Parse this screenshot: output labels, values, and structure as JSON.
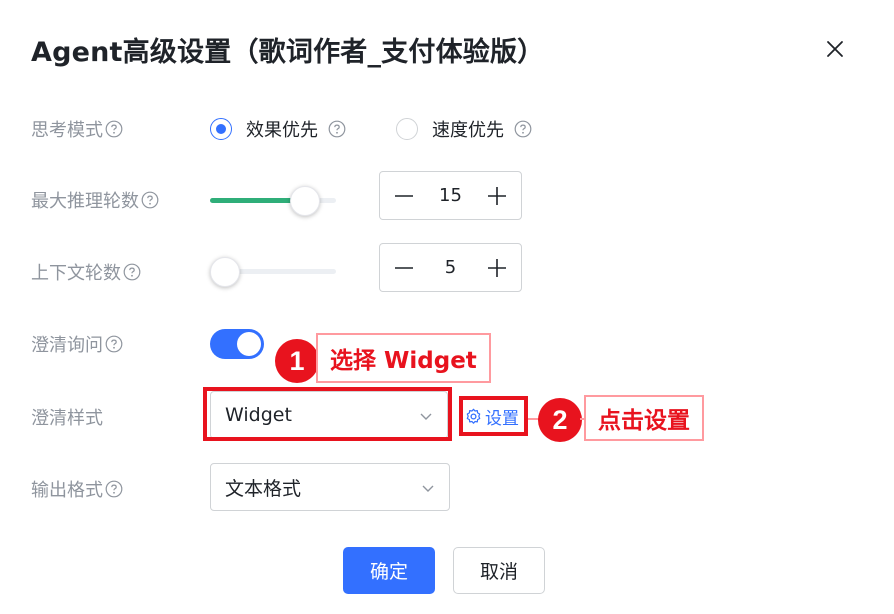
{
  "dialog": {
    "title": "Agent高级设置（歌词作者_支付体验版）",
    "close_icon": "close-icon"
  },
  "thinking_mode": {
    "label": "思考模式",
    "options": [
      {
        "label": "效果优先",
        "selected": true
      },
      {
        "label": "速度优先",
        "selected": false
      }
    ]
  },
  "max_rounds": {
    "label": "最大推理轮数",
    "value": "15",
    "slider_level": 0.75
  },
  "context_rounds": {
    "label": "上下文轮数",
    "value": "5",
    "slider_level": 0.0
  },
  "clarify_ask": {
    "label": "澄清询问",
    "enabled": true
  },
  "clarify_style": {
    "label": "澄清样式",
    "value": "Widget",
    "settings_link": "设置"
  },
  "output_format": {
    "label": "输出格式",
    "value": "文本格式"
  },
  "annotations": {
    "step1_number": "1",
    "step1_text": "选择 Widget",
    "step2_number": "2",
    "step2_text": "点击设置"
  },
  "footer": {
    "confirm_label": "确定",
    "cancel_label": "取消"
  },
  "colors": {
    "primary": "#3370ff",
    "slider_fill": "#2fae79",
    "annotation_red": "#e8131e",
    "label_gray": "#8f959e"
  }
}
